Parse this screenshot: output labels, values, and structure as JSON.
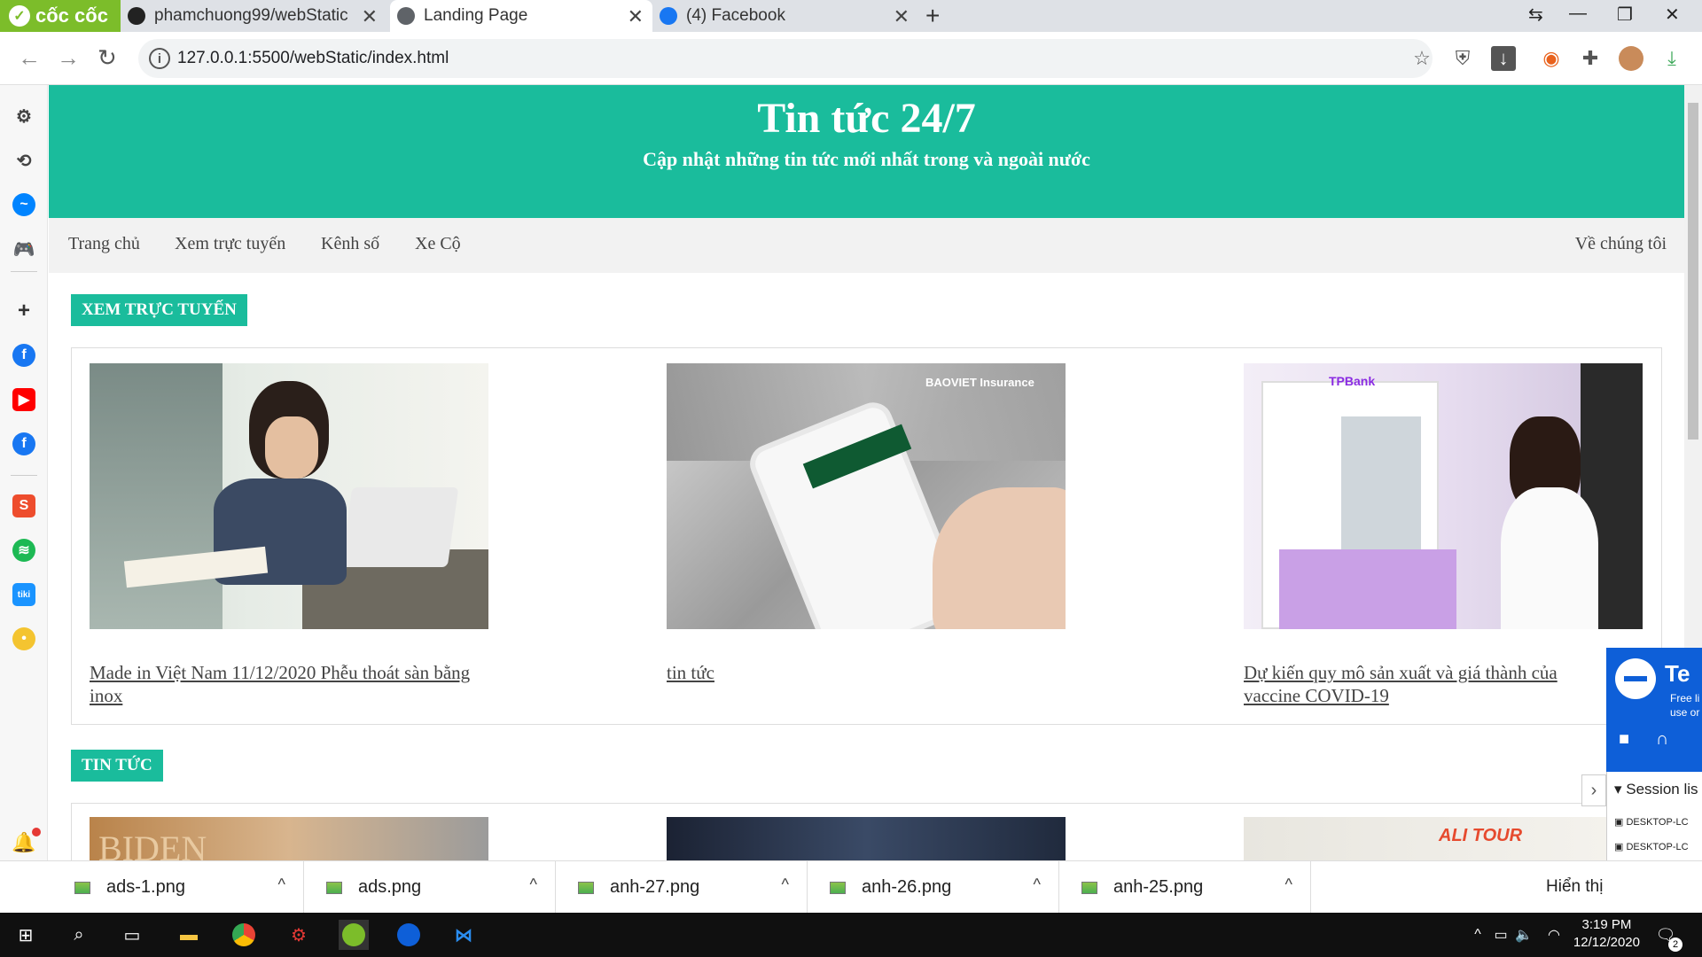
{
  "browser": {
    "brand": "cốc cốc",
    "tabs": [
      {
        "title": "phamchuong99/webStatic",
        "icon": "github-icon"
      },
      {
        "title": "Landing Page",
        "icon": "globe-icon"
      },
      {
        "title": "(4) Facebook",
        "icon": "facebook-icon"
      }
    ],
    "url": "127.0.0.1:5500/webStatic/index.html"
  },
  "sidebar_icons": [
    "settings-icon",
    "history-icon",
    "messenger-icon",
    "game-icon",
    "add-icon",
    "facebook-icon",
    "youtube-icon",
    "facebook-icon",
    "shopee-icon",
    "spotify-icon",
    "tiki-icon",
    "chick-icon",
    "bell-icon",
    "more-icon"
  ],
  "site": {
    "title": "Tin tức 24/7",
    "subtitle": "Cập nhật những tin tức mới nhất trong và ngoài nước",
    "nav": [
      "Trang chủ",
      "Xem trực tuyến",
      "Kênh số",
      "Xe Cộ"
    ],
    "nav_right": "Về chúng tôi",
    "section1": {
      "tag": "XEM TRỰC TUYẾN",
      "items": [
        {
          "caption": "Made in Việt Nam 11/12/2020 Phễu thoát sàn bằng inox"
        },
        {
          "caption": "tin tức",
          "image_text": "BAOVIET Insurance"
        },
        {
          "caption": "Dự kiến quy mô sản xuất và giá thành của vaccine COVID-19",
          "image_text": "TPBank"
        }
      ]
    },
    "section2": {
      "tag": "TIN TỨC",
      "image_texts": [
        "BIDEN",
        "ALI TOUR"
      ]
    }
  },
  "teamviewer": {
    "title": "Te",
    "line1": "Free li",
    "line2": "use or",
    "session": "Session lis",
    "devices": [
      "DESKTOP-LC",
      "DESKTOP-LC"
    ]
  },
  "downloads": {
    "files": [
      "ads-1.png",
      "ads.png",
      "anh-27.png",
      "anh-26.png",
      "anh-25.png"
    ],
    "show_all": "Hiển thị"
  },
  "taskbar": {
    "time": "3:19 PM",
    "date": "12/12/2020",
    "notifications": "2"
  }
}
